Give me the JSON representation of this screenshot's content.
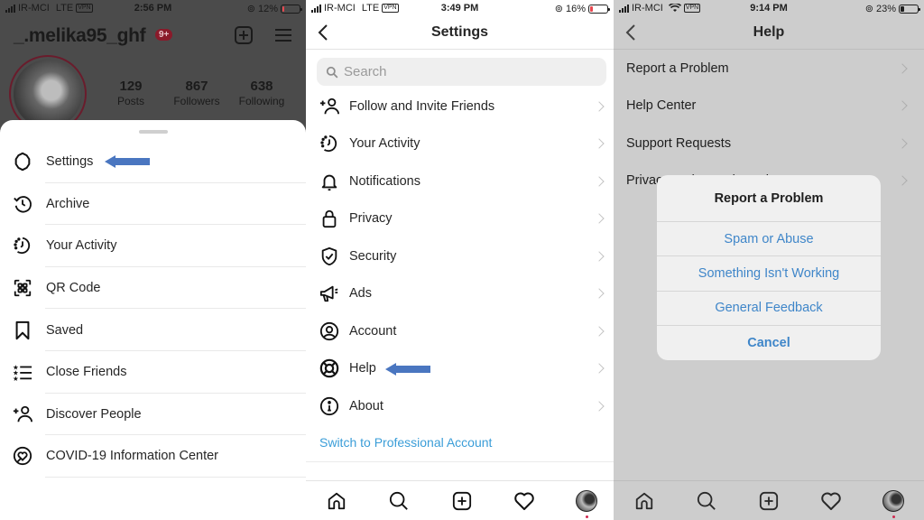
{
  "panel_profile": {
    "status": {
      "carrier": "IR-MCI",
      "network": "LTE",
      "vpn": "VPN",
      "time": "2:56 PM",
      "battery": "12%",
      "battery_level": 0.12,
      "battery_color": "#e8474f"
    },
    "username": "_.melika95_ghf",
    "notification_badge": "9+",
    "stats": [
      {
        "value": "129",
        "label": "Posts"
      },
      {
        "value": "867",
        "label": "Followers"
      },
      {
        "value": "638",
        "label": "Following"
      }
    ],
    "menu_items": [
      {
        "label": "Settings",
        "icon": "gear-icon"
      },
      {
        "label": "Archive",
        "icon": "archive-icon"
      },
      {
        "label": "Your Activity",
        "icon": "activity-icon"
      },
      {
        "label": "QR Code",
        "icon": "qr-code-icon"
      },
      {
        "label": "Saved",
        "icon": "bookmark-icon"
      },
      {
        "label": "Close Friends",
        "icon": "close-friends-icon"
      },
      {
        "label": "Discover People",
        "icon": "add-person-icon"
      },
      {
        "label": "COVID-19 Information Center",
        "icon": "covid-heart-icon"
      }
    ]
  },
  "panel_settings": {
    "status": {
      "carrier": "IR-MCI",
      "network": "LTE",
      "vpn": "VPN",
      "time": "3:49 PM",
      "battery": "16%",
      "battery_level": 0.16,
      "battery_color": "#e8474f"
    },
    "title": "Settings",
    "search_placeholder": "Search",
    "items": [
      {
        "label": "Follow and Invite Friends",
        "icon": "add-person-icon"
      },
      {
        "label": "Your Activity",
        "icon": "activity-icon"
      },
      {
        "label": "Notifications",
        "icon": "bell-icon"
      },
      {
        "label": "Privacy",
        "icon": "lock-icon"
      },
      {
        "label": "Security",
        "icon": "shield-icon"
      },
      {
        "label": "Ads",
        "icon": "megaphone-icon"
      },
      {
        "label": "Account",
        "icon": "account-icon"
      },
      {
        "label": "Help",
        "icon": "lifebuoy-icon"
      },
      {
        "label": "About",
        "icon": "info-icon"
      }
    ],
    "switch_link": "Switch to Professional Account",
    "link_color": "#3a9dd8"
  },
  "panel_help": {
    "status": {
      "carrier": "IR-MCI",
      "network": "wifi",
      "vpn": "VPN",
      "time": "9:14 PM",
      "battery": "23%",
      "battery_level": 0.23,
      "battery_color": "#1e1e1e"
    },
    "title": "Help",
    "items": [
      {
        "label": "Report a Problem"
      },
      {
        "label": "Help Center"
      },
      {
        "label": "Support Requests"
      },
      {
        "label": "Privacy and Security Help"
      }
    ],
    "alert": {
      "title": "Report a Problem",
      "buttons": [
        "Spam or Abuse",
        "Something Isn't Working",
        "General Feedback",
        "Cancel"
      ],
      "button_color": "#3f86c9"
    }
  },
  "tabbar": [
    "home-icon",
    "search-icon",
    "new-post-icon",
    "heart-icon",
    "profile-avatar"
  ],
  "annotation_arrow_color": "#4a76c0"
}
